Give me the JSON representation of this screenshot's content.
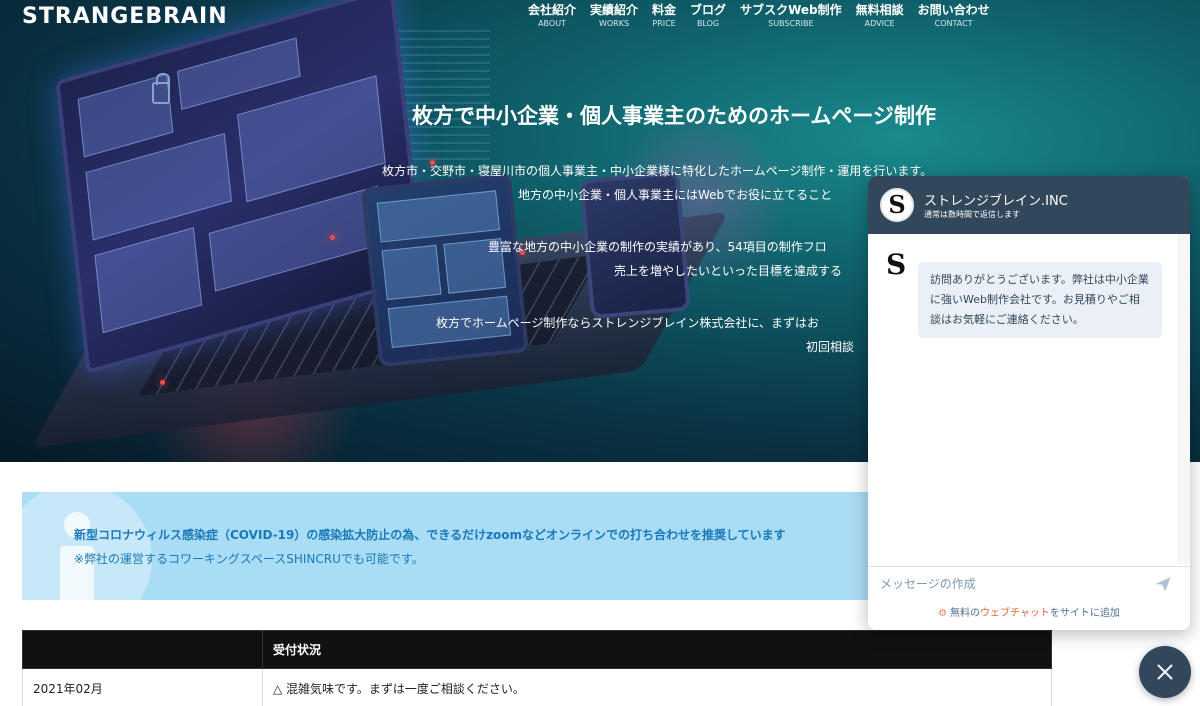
{
  "brand": {
    "logo_text": "STRANGEBRAIN"
  },
  "nav": [
    {
      "ja": "会社紹介",
      "en": "ABOUT"
    },
    {
      "ja": "実績紹介",
      "en": "WORKS"
    },
    {
      "ja": "料金",
      "en": "PRICE"
    },
    {
      "ja": "ブログ",
      "en": "BLOG"
    },
    {
      "ja": "サブスクWeb制作",
      "en": "SUBSCRIBE"
    },
    {
      "ja": "無料相談",
      "en": "ADVICE"
    },
    {
      "ja": "お問い合わせ",
      "en": "CONTACT"
    }
  ],
  "hero": {
    "title": "枚方で中小企業・個人事業主のためのホームページ制作",
    "lines": [
      "枚方市・交野市・寝屋川市の個人事業主・中小企業様に特化したホームページ制作・運用を行います。",
      "地方の中小企業・個人事業主にはWebでお役に立てること",
      "豊富な地方の中小企業の制作の実績があり、54項目の制作フロ",
      "売上を増やしたいといった目標を達成する",
      "枚方でホームページ制作ならストレンジブレイン株式会社に、まずはお",
      "初回相談"
    ]
  },
  "notice": {
    "line1": "新型コロナウィルス感染症（COVID-19）の感染拡大防止の為、できるだけzoomなどオンラインでの打ち合わせを推奨しています",
    "line2": "※弊社の運営するコワーキングスペースSHINCRUでも可能です。"
  },
  "table": {
    "headers": [
      "",
      "受付状況"
    ],
    "rows": [
      {
        "date": "2021年02月",
        "status": "△ 混雑気味です。まずは一度ご相談ください。"
      }
    ]
  },
  "chat": {
    "avatar_letter": "S",
    "company_name": "ストレンジブレイン.INC",
    "response_time": "通常は数時間で返信します",
    "message": "訪問ありがとうございます。弊社は中小企業に強いWeb制作会社です。お見積りやご相談はお気軽にご連絡ください。",
    "input_placeholder": "メッセージの作成",
    "footer_prefix": "無料の",
    "footer_link": "ウェブチャット",
    "footer_suffix": "をサイトに追加"
  },
  "colors": {
    "chat_header": "#33475b",
    "notice_bg": "#a9dcf5",
    "notice_text": "#1a79b8",
    "table_header": "#111111"
  },
  "icons": {
    "send": "send-icon",
    "close": "close-icon",
    "hubspot": "hubspot-sprocket-icon"
  }
}
